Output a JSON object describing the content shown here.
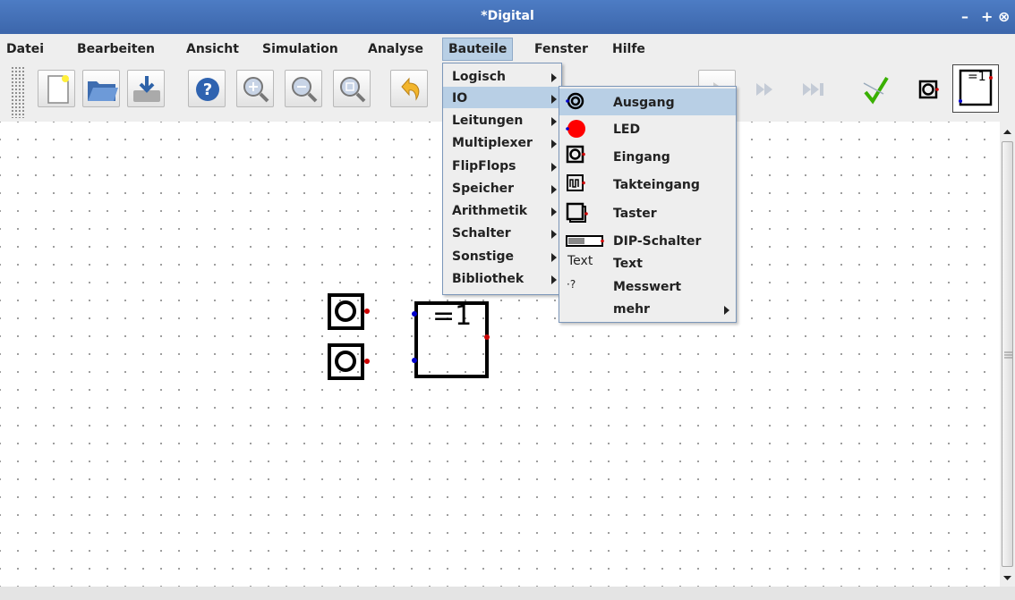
{
  "window": {
    "title": "*Digital",
    "controls": [
      "–",
      "+",
      "⊗"
    ]
  },
  "menubar": {
    "items": [
      "Datei",
      "Bearbeiten",
      "Ansicht",
      "Simulation",
      "Analyse",
      "Bauteile",
      "Fenster",
      "Hilfe"
    ],
    "active": "Bauteile"
  },
  "toolbar": {
    "buttons": [
      "new-file-icon",
      "open-folder-icon",
      "save-icon",
      "help-icon",
      "zoom-in-icon",
      "zoom-out-icon",
      "zoom-fit-icon",
      "undo-icon",
      "step-icon",
      "run-to-break-icon",
      "run-to-end-icon",
      "analyse-icon",
      "input-component-icon",
      "xor-gate-icon"
    ],
    "xor_label": "=1"
  },
  "bauteile_menu": {
    "items": [
      "Logisch",
      "IO",
      "Leitungen",
      "Multiplexer",
      "FlipFlops",
      "Speicher",
      "Arithmetik",
      "Schalter",
      "Sonstige",
      "Bibliothek"
    ],
    "highlighted": "IO"
  },
  "io_submenu": {
    "items": [
      {
        "label": "Ausgang",
        "icon": "output-icon"
      },
      {
        "label": "LED",
        "icon": "led-icon"
      },
      {
        "label": "Eingang",
        "icon": "input-icon"
      },
      {
        "label": "Takteingang",
        "icon": "clock-icon"
      },
      {
        "label": "Taster",
        "icon": "button-icon"
      },
      {
        "label": "DIP-Schalter",
        "icon": "dip-switch-icon"
      },
      {
        "label": "Text",
        "icon": "text-icon",
        "icon_text": "Text"
      },
      {
        "label": "Messwert",
        "icon": "probe-icon",
        "icon_text": "·?"
      },
      {
        "label": "mehr",
        "icon": ""
      }
    ],
    "highlighted": "Ausgang"
  },
  "canvas": {
    "xor_gate_label": "=1"
  },
  "colors": {
    "titlebar": "#4470b8",
    "highlight": "#b8cfe5",
    "pin_red": "#cc0000",
    "pin_blue": "#0000cc",
    "led_red": "#ff0000"
  }
}
